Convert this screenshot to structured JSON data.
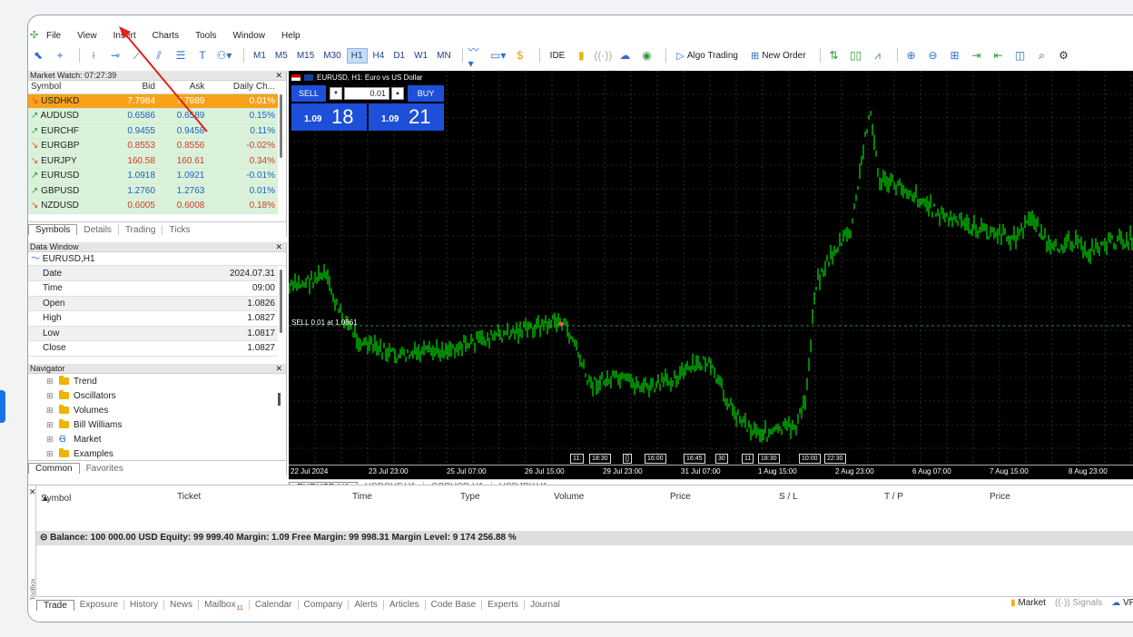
{
  "menu": [
    "File",
    "View",
    "Insert",
    "Charts",
    "Tools",
    "Window",
    "Help"
  ],
  "toolbar": {
    "timeframes": [
      "M1",
      "M5",
      "M15",
      "M30",
      "H1",
      "H4",
      "D1",
      "W1",
      "MN"
    ],
    "active_timeframe": "H1",
    "ide_label": "IDE",
    "algo_trading_label": "Algo Trading",
    "new_order_label": "New Order"
  },
  "market_watch": {
    "title": "Market Watch: 07:27:39",
    "columns": [
      "Symbol",
      "Bid",
      "Ask",
      "Daily Ch..."
    ],
    "rows": [
      {
        "symbol": "USDHKD",
        "bid": "7.7984",
        "ask": "7.7989",
        "change": "0.01%",
        "dir": "down"
      },
      {
        "symbol": "AUDUSD",
        "bid": "0.6586",
        "ask": "0.6589",
        "change": "0.15%",
        "dir": "up"
      },
      {
        "symbol": "EURCHF",
        "bid": "0.9455",
        "ask": "0.9458",
        "change": "0.11%",
        "dir": "up"
      },
      {
        "symbol": "EURGBP",
        "bid": "0.8553",
        "ask": "0.8556",
        "change": "-0.02%",
        "dir": "down"
      },
      {
        "symbol": "EURJPY",
        "bid": "160.58",
        "ask": "160.61",
        "change": "0.34%",
        "dir": "down"
      },
      {
        "symbol": "EURUSD",
        "bid": "1.0918",
        "ask": "1.0921",
        "change": "-0.01%",
        "dir": "up"
      },
      {
        "symbol": "GBPUSD",
        "bid": "1.2760",
        "ask": "1.2763",
        "change": "0.01%",
        "dir": "up"
      },
      {
        "symbol": "NZDUSD",
        "bid": "0.6005",
        "ask": "0.6008",
        "change": "0.18%",
        "dir": "down"
      }
    ],
    "tabs": [
      "Symbols",
      "Details",
      "Trading",
      "Ticks"
    ]
  },
  "data_window": {
    "title": "Data Window",
    "instrument": "EURUSD,H1",
    "rows": [
      {
        "label": "Date",
        "value": "2024.07.31"
      },
      {
        "label": "Time",
        "value": "09:00"
      },
      {
        "label": "Open",
        "value": "1.0826"
      },
      {
        "label": "High",
        "value": "1.0827"
      },
      {
        "label": "Low",
        "value": "1.0817"
      },
      {
        "label": "Close",
        "value": "1.0827"
      }
    ]
  },
  "navigator": {
    "title": "Navigator",
    "items": [
      "Trend",
      "Oscillators",
      "Volumes",
      "Bill Williams",
      "Market",
      "Examples"
    ],
    "tabs": [
      "Common",
      "Favorites"
    ]
  },
  "chart": {
    "title": "EURUSD, H1:  Euro vs US Dollar",
    "sell_label": "SELL",
    "buy_label": "BUY",
    "volume": "0.01",
    "sell_price_small": "1.09",
    "sell_price_big": "18",
    "buy_price_small": "1.09",
    "buy_price_big": "21",
    "position_label": "SELL 0.01 at 1.0861",
    "x_labels": [
      "22 Jul 2024",
      "23 Jul 23:00",
      "25 Jul 07:00",
      "26 Jul 15:00",
      "29 Jul 23:00",
      "31 Jul 07:00",
      "1 Aug 15:00",
      "2 Aug 23:00",
      "6 Aug 07:00",
      "7 Aug 15:00",
      "8 Aug 23:00"
    ],
    "session_tags": [
      "11:",
      "18:30",
      "[]",
      "16:00",
      "16:45",
      "30",
      "11",
      "18:30",
      "10:00",
      "22:30"
    ],
    "tabs": [
      "EURUSD,H1",
      "USDCHF,H1",
      "GBPUSD,H1",
      "USDJPY,H1"
    ],
    "colors": {
      "candles": "#00e000",
      "background": "#000000",
      "grid": "#4a4a4a",
      "trade_panel": "#1e4fd8"
    }
  },
  "toolbox": {
    "side_label": "Toolbox",
    "columns": [
      "Symbol",
      "Ticket",
      "Time",
      "Type",
      "Volume",
      "Price",
      "S / L",
      "T / P",
      "Price"
    ],
    "balance": "Balance: 100 000.00 USD  Equity: 99 999.40  Margin: 1.09  Free Margin: 99 998.31  Margin Level: 9 174 256.88 %",
    "tabs": [
      "Trade",
      "Exposure",
      "History",
      "News",
      "Mailbox",
      "Calendar",
      "Company",
      "Alerts",
      "Articles",
      "Code Base",
      "Experts",
      "Journal"
    ],
    "mailbox_badge": "11",
    "status": {
      "market": "Market",
      "signals": "Signals",
      "vps": "VPS"
    }
  },
  "annotation": {
    "color": "#e02020",
    "target": "Insert"
  }
}
